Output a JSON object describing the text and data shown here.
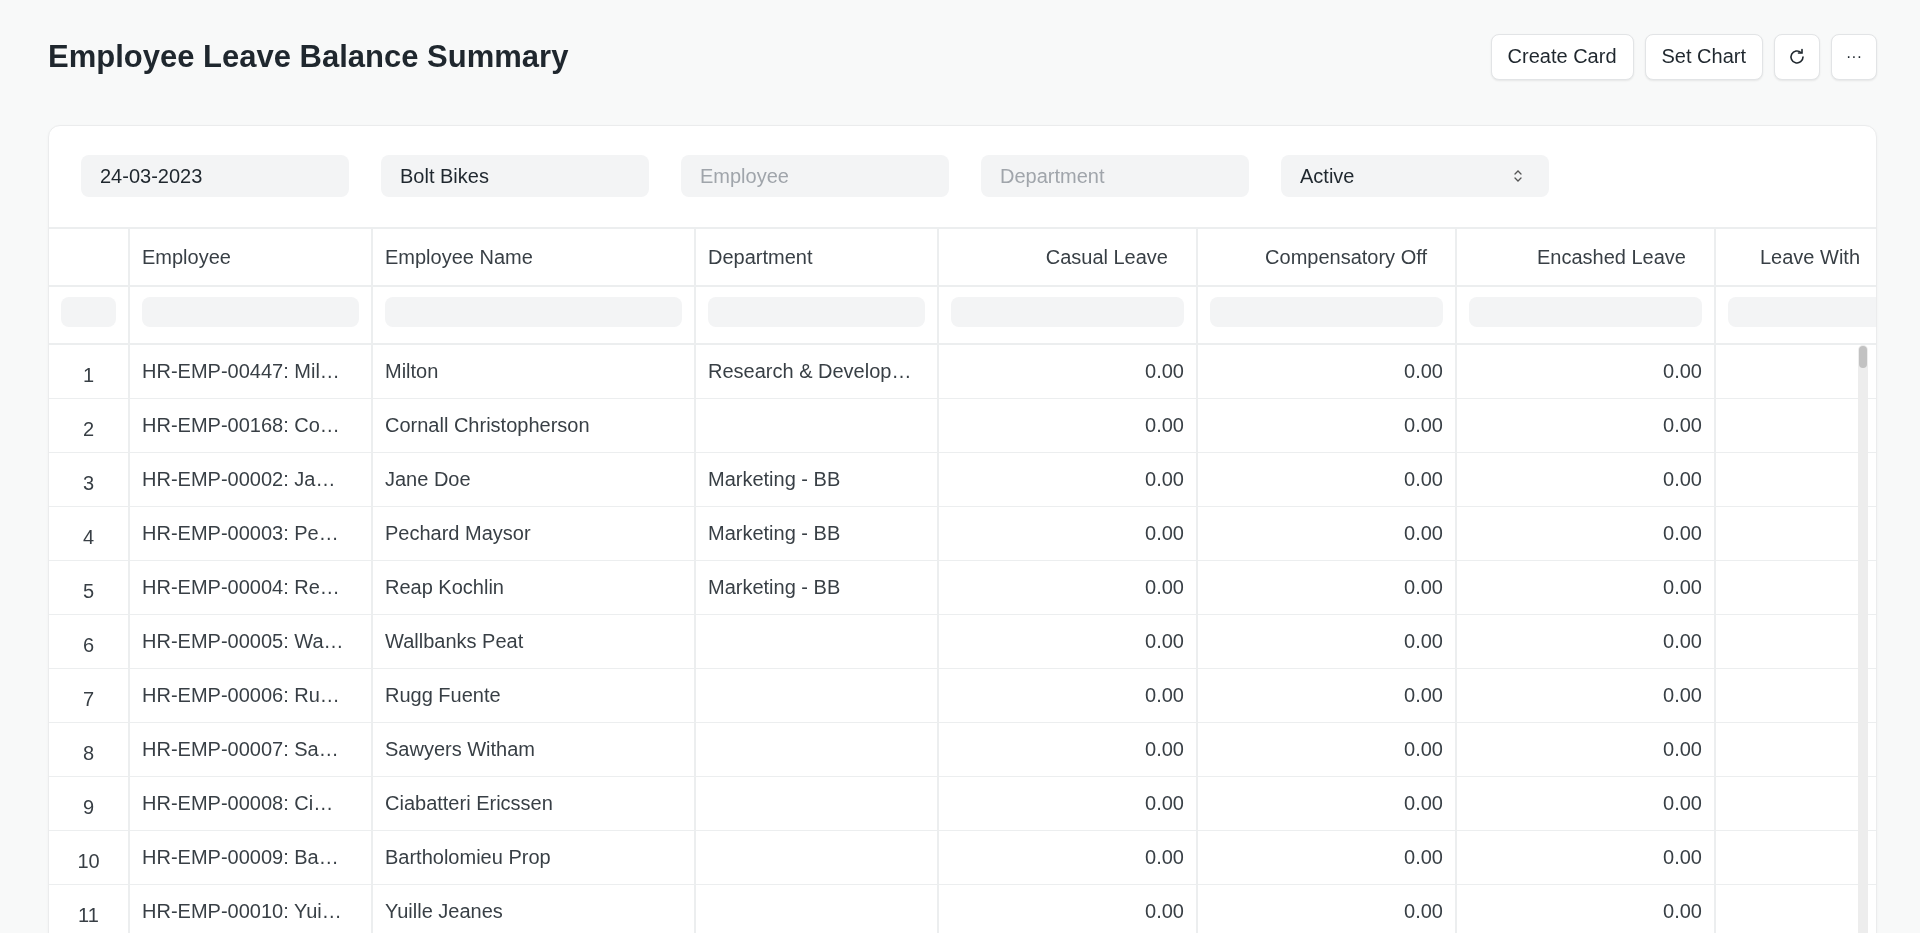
{
  "page": {
    "title": "Employee Leave Balance Summary"
  },
  "actions": [
    {
      "kind": "text",
      "label": "Create Card"
    },
    {
      "kind": "text",
      "label": "Set Chart"
    },
    {
      "kind": "refresh"
    },
    {
      "kind": "more",
      "label": "···"
    }
  ],
  "filters": [
    {
      "kind": "value",
      "value": "24-03-2023"
    },
    {
      "kind": "value",
      "value": "Bolt Bikes"
    },
    {
      "kind": "placeholder",
      "placeholder": "Employee"
    },
    {
      "kind": "placeholder",
      "placeholder": "Department"
    },
    {
      "kind": "select",
      "value": "Active"
    }
  ],
  "table": {
    "columns": [
      {
        "kind": "index"
      },
      {
        "kind": "text",
        "label": "Employee"
      },
      {
        "kind": "text",
        "label": "Employee Name"
      },
      {
        "kind": "text",
        "label": "Department"
      },
      {
        "kind": "number",
        "label": "Casual Leave"
      },
      {
        "kind": "number",
        "label": "Compensatory Off"
      },
      {
        "kind": "number",
        "label": "Encashed Leave"
      },
      {
        "kind": "number",
        "label": "Leave With"
      }
    ],
    "rows": [
      {
        "cells": [
          "1",
          "HR-EMP-00447: Mil…",
          "Milton",
          "Research & Develop…",
          "0.00",
          "0.00",
          "0.00",
          null
        ]
      },
      {
        "cells": [
          "2",
          "HR-EMP-00168: Co…",
          "Cornall Christopherson",
          null,
          "0.00",
          "0.00",
          "0.00",
          null
        ]
      },
      {
        "cells": [
          "3",
          "HR-EMP-00002: Ja…",
          "Jane Doe",
          "Marketing - BB",
          "0.00",
          "0.00",
          "0.00",
          null
        ]
      },
      {
        "cells": [
          "4",
          "HR-EMP-00003: Pe…",
          "Pechard Maysor",
          "Marketing - BB",
          "0.00",
          "0.00",
          "0.00",
          null
        ]
      },
      {
        "cells": [
          "5",
          "HR-EMP-00004: Re…",
          "Reap Kochlin",
          "Marketing - BB",
          "0.00",
          "0.00",
          "0.00",
          null
        ]
      },
      {
        "cells": [
          "6",
          "HR-EMP-00005: Wa…",
          "Wallbanks Peat",
          null,
          "0.00",
          "0.00",
          "0.00",
          null
        ]
      },
      {
        "cells": [
          "7",
          "HR-EMP-00006: Ru…",
          "Rugg Fuente",
          null,
          "0.00",
          "0.00",
          "0.00",
          null
        ]
      },
      {
        "cells": [
          "8",
          "HR-EMP-00007: Sa…",
          "Sawyers Witham",
          null,
          "0.00",
          "0.00",
          "0.00",
          null
        ]
      },
      {
        "cells": [
          "9",
          "HR-EMP-00008: Ci…",
          "Ciabatteri Ericssen",
          null,
          "0.00",
          "0.00",
          "0.00",
          null
        ]
      },
      {
        "cells": [
          "10",
          "HR-EMP-00009: Ba…",
          "Bartholomieu Prop",
          null,
          "0.00",
          "0.00",
          "0.00",
          null
        ]
      },
      {
        "cells": [
          "11",
          "HR-EMP-00010: Yui…",
          "Yuille Jeanes",
          null,
          "0.00",
          "0.00",
          "0.00",
          null
        ]
      }
    ]
  }
}
